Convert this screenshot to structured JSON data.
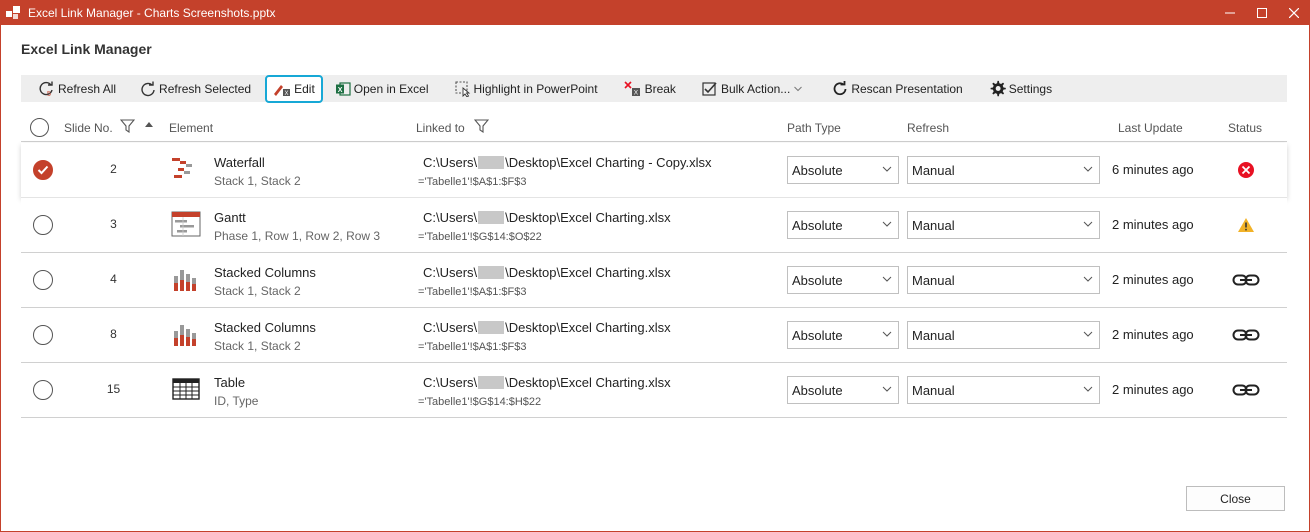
{
  "window": {
    "title": "Excel Link Manager - Charts Screenshots.pptx"
  },
  "heading": "Excel Link Manager",
  "toolbar": {
    "refresh_all": "Refresh All",
    "refresh_selected": "Refresh Selected",
    "edit": "Edit",
    "open_in_excel": "Open in Excel",
    "highlight": "Highlight in PowerPoint",
    "break": "Break",
    "bulk_actions": "Bulk Action...",
    "rescan": "Rescan Presentation",
    "settings": "Settings"
  },
  "columns": {
    "slide_no": "Slide No.",
    "element": "Element",
    "linked_to": "Linked to",
    "path_type": "Path Type",
    "refresh": "Refresh",
    "last_update": "Last Update",
    "status": "Status"
  },
  "rows": [
    {
      "selected": true,
      "slide": "2",
      "icon": "waterfall-chart-icon",
      "name": "Waterfall",
      "sub": "Stack 1, Stack 2",
      "path_prefix": "C:\\Users\\",
      "path_suffix": "\\Desktop\\Excel Charting - Copy.xlsx",
      "range": "='Tabelle1'!$A$1:$F$3",
      "path_type": "Absolute",
      "refresh": "Manual",
      "updated": "6 minutes ago",
      "status": "error-icon"
    },
    {
      "selected": false,
      "slide": "3",
      "icon": "gantt-chart-icon",
      "name": "Gantt",
      "sub": "Phase 1, Row 1, Row 2, Row 3",
      "path_prefix": "C:\\Users\\",
      "path_suffix": "\\Desktop\\Excel Charting.xlsx",
      "range": "='Tabelle1'!$G$14:$O$22",
      "path_type": "Absolute",
      "refresh": "Manual",
      "updated": "2 minutes ago",
      "status": "warning-icon"
    },
    {
      "selected": false,
      "slide": "4",
      "icon": "stacked-column-chart-icon",
      "name": "Stacked Columns",
      "sub": "Stack 1, Stack 2",
      "path_prefix": "C:\\Users\\",
      "path_suffix": "\\Desktop\\Excel Charting.xlsx",
      "range": "='Tabelle1'!$A$1:$F$3",
      "path_type": "Absolute",
      "refresh": "Manual",
      "updated": "2 minutes ago",
      "status": "link-icon"
    },
    {
      "selected": false,
      "slide": "8",
      "icon": "stacked-column-chart-icon",
      "name": "Stacked Columns",
      "sub": "Stack 1, Stack 2",
      "path_prefix": "C:\\Users\\",
      "path_suffix": "\\Desktop\\Excel Charting.xlsx",
      "range": "='Tabelle1'!$A$1:$F$3",
      "path_type": "Absolute",
      "refresh": "Manual",
      "updated": "2 minutes ago",
      "status": "link-icon"
    },
    {
      "selected": false,
      "slide": "15",
      "icon": "table-icon",
      "name": "Table",
      "sub": "ID, Type",
      "path_prefix": "C:\\Users\\",
      "path_suffix": "\\Desktop\\Excel Charting.xlsx",
      "range": "='Tabelle1'!$G$14:$H$22",
      "path_type": "Absolute",
      "refresh": "Manual",
      "updated": "2 minutes ago",
      "status": "link-icon"
    }
  ],
  "close": "Close",
  "colors": {
    "accent": "#c4412b",
    "highlight": "#17a8d6",
    "error": "#e81123",
    "warning": "#f2b227"
  }
}
